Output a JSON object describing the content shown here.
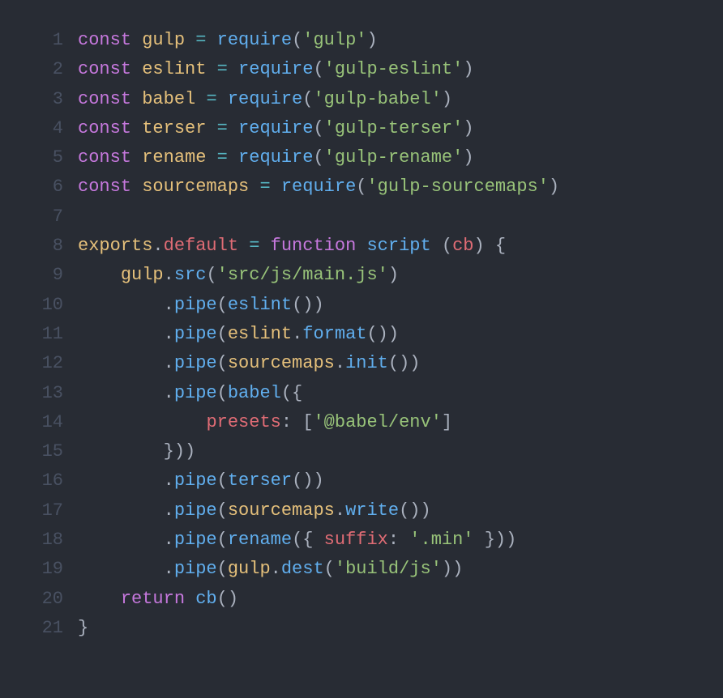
{
  "lines": [
    {
      "num": "1",
      "tokens": [
        {
          "c": "kw",
          "t": "const"
        },
        {
          "c": "pun",
          "t": " "
        },
        {
          "c": "var",
          "t": "gulp"
        },
        {
          "c": "pun",
          "t": " "
        },
        {
          "c": "op",
          "t": "="
        },
        {
          "c": "pun",
          "t": " "
        },
        {
          "c": "fn",
          "t": "require"
        },
        {
          "c": "pun",
          "t": "("
        },
        {
          "c": "str",
          "t": "'gulp'"
        },
        {
          "c": "pun",
          "t": ")"
        }
      ]
    },
    {
      "num": "2",
      "tokens": [
        {
          "c": "kw",
          "t": "const"
        },
        {
          "c": "pun",
          "t": " "
        },
        {
          "c": "var",
          "t": "eslint"
        },
        {
          "c": "pun",
          "t": " "
        },
        {
          "c": "op",
          "t": "="
        },
        {
          "c": "pun",
          "t": " "
        },
        {
          "c": "fn",
          "t": "require"
        },
        {
          "c": "pun",
          "t": "("
        },
        {
          "c": "str",
          "t": "'gulp-eslint'"
        },
        {
          "c": "pun",
          "t": ")"
        }
      ]
    },
    {
      "num": "3",
      "tokens": [
        {
          "c": "kw",
          "t": "const"
        },
        {
          "c": "pun",
          "t": " "
        },
        {
          "c": "var",
          "t": "babel"
        },
        {
          "c": "pun",
          "t": " "
        },
        {
          "c": "op",
          "t": "="
        },
        {
          "c": "pun",
          "t": " "
        },
        {
          "c": "fn",
          "t": "require"
        },
        {
          "c": "pun",
          "t": "("
        },
        {
          "c": "str",
          "t": "'gulp-babel'"
        },
        {
          "c": "pun",
          "t": ")"
        }
      ]
    },
    {
      "num": "4",
      "tokens": [
        {
          "c": "kw",
          "t": "const"
        },
        {
          "c": "pun",
          "t": " "
        },
        {
          "c": "var",
          "t": "terser"
        },
        {
          "c": "pun",
          "t": " "
        },
        {
          "c": "op",
          "t": "="
        },
        {
          "c": "pun",
          "t": " "
        },
        {
          "c": "fn",
          "t": "require"
        },
        {
          "c": "pun",
          "t": "("
        },
        {
          "c": "str",
          "t": "'gulp-terser'"
        },
        {
          "c": "pun",
          "t": ")"
        }
      ]
    },
    {
      "num": "5",
      "tokens": [
        {
          "c": "kw",
          "t": "const"
        },
        {
          "c": "pun",
          "t": " "
        },
        {
          "c": "var",
          "t": "rename"
        },
        {
          "c": "pun",
          "t": " "
        },
        {
          "c": "op",
          "t": "="
        },
        {
          "c": "pun",
          "t": " "
        },
        {
          "c": "fn",
          "t": "require"
        },
        {
          "c": "pun",
          "t": "("
        },
        {
          "c": "str",
          "t": "'gulp-rename'"
        },
        {
          "c": "pun",
          "t": ")"
        }
      ]
    },
    {
      "num": "6",
      "tokens": [
        {
          "c": "kw",
          "t": "const"
        },
        {
          "c": "pun",
          "t": " "
        },
        {
          "c": "var",
          "t": "sourcemaps"
        },
        {
          "c": "pun",
          "t": " "
        },
        {
          "c": "op",
          "t": "="
        },
        {
          "c": "pun",
          "t": " "
        },
        {
          "c": "fn",
          "t": "require"
        },
        {
          "c": "pun",
          "t": "("
        },
        {
          "c": "str",
          "t": "'gulp-sourcemaps'"
        },
        {
          "c": "pun",
          "t": ")"
        }
      ]
    },
    {
      "num": "7",
      "tokens": []
    },
    {
      "num": "8",
      "tokens": [
        {
          "c": "var",
          "t": "exports"
        },
        {
          "c": "pun",
          "t": "."
        },
        {
          "c": "prop",
          "t": "default"
        },
        {
          "c": "pun",
          "t": " "
        },
        {
          "c": "op",
          "t": "="
        },
        {
          "c": "pun",
          "t": " "
        },
        {
          "c": "kw",
          "t": "function"
        },
        {
          "c": "pun",
          "t": " "
        },
        {
          "c": "fn",
          "t": "script"
        },
        {
          "c": "pun",
          "t": " ("
        },
        {
          "c": "param",
          "t": "cb"
        },
        {
          "c": "pun",
          "t": ") {"
        }
      ]
    },
    {
      "num": "9",
      "tokens": [
        {
          "c": "pun",
          "t": "    "
        },
        {
          "c": "var",
          "t": "gulp"
        },
        {
          "c": "pun",
          "t": "."
        },
        {
          "c": "mem",
          "t": "src"
        },
        {
          "c": "pun",
          "t": "("
        },
        {
          "c": "str",
          "t": "'src/js/main.js'"
        },
        {
          "c": "pun",
          "t": ")"
        }
      ]
    },
    {
      "num": "10",
      "tokens": [
        {
          "c": "pun",
          "t": "        ."
        },
        {
          "c": "mem",
          "t": "pipe"
        },
        {
          "c": "pun",
          "t": "("
        },
        {
          "c": "fn",
          "t": "eslint"
        },
        {
          "c": "pun",
          "t": "())"
        }
      ]
    },
    {
      "num": "11",
      "tokens": [
        {
          "c": "pun",
          "t": "        ."
        },
        {
          "c": "mem",
          "t": "pipe"
        },
        {
          "c": "pun",
          "t": "("
        },
        {
          "c": "var",
          "t": "eslint"
        },
        {
          "c": "pun",
          "t": "."
        },
        {
          "c": "mem",
          "t": "format"
        },
        {
          "c": "pun",
          "t": "())"
        }
      ]
    },
    {
      "num": "12",
      "tokens": [
        {
          "c": "pun",
          "t": "        ."
        },
        {
          "c": "mem",
          "t": "pipe"
        },
        {
          "c": "pun",
          "t": "("
        },
        {
          "c": "var",
          "t": "sourcemaps"
        },
        {
          "c": "pun",
          "t": "."
        },
        {
          "c": "mem",
          "t": "init"
        },
        {
          "c": "pun",
          "t": "())"
        }
      ]
    },
    {
      "num": "13",
      "tokens": [
        {
          "c": "pun",
          "t": "        ."
        },
        {
          "c": "mem",
          "t": "pipe"
        },
        {
          "c": "pun",
          "t": "("
        },
        {
          "c": "fn",
          "t": "babel"
        },
        {
          "c": "pun",
          "t": "({"
        }
      ]
    },
    {
      "num": "14",
      "tokens": [
        {
          "c": "pun",
          "t": "            "
        },
        {
          "c": "prop",
          "t": "presets"
        },
        {
          "c": "pun",
          "t": ": ["
        },
        {
          "c": "str",
          "t": "'@babel/env'"
        },
        {
          "c": "pun",
          "t": "]"
        }
      ]
    },
    {
      "num": "15",
      "tokens": [
        {
          "c": "pun",
          "t": "        }))"
        }
      ]
    },
    {
      "num": "16",
      "tokens": [
        {
          "c": "pun",
          "t": "        ."
        },
        {
          "c": "mem",
          "t": "pipe"
        },
        {
          "c": "pun",
          "t": "("
        },
        {
          "c": "fn",
          "t": "terser"
        },
        {
          "c": "pun",
          "t": "())"
        }
      ]
    },
    {
      "num": "17",
      "tokens": [
        {
          "c": "pun",
          "t": "        ."
        },
        {
          "c": "mem",
          "t": "pipe"
        },
        {
          "c": "pun",
          "t": "("
        },
        {
          "c": "var",
          "t": "sourcemaps"
        },
        {
          "c": "pun",
          "t": "."
        },
        {
          "c": "mem",
          "t": "write"
        },
        {
          "c": "pun",
          "t": "())"
        }
      ]
    },
    {
      "num": "18",
      "tokens": [
        {
          "c": "pun",
          "t": "        ."
        },
        {
          "c": "mem",
          "t": "pipe"
        },
        {
          "c": "pun",
          "t": "("
        },
        {
          "c": "fn",
          "t": "rename"
        },
        {
          "c": "pun",
          "t": "({ "
        },
        {
          "c": "prop",
          "t": "suffix"
        },
        {
          "c": "pun",
          "t": ": "
        },
        {
          "c": "str",
          "t": "'.min'"
        },
        {
          "c": "pun",
          "t": " }))"
        }
      ]
    },
    {
      "num": "19",
      "tokens": [
        {
          "c": "pun",
          "t": "        ."
        },
        {
          "c": "mem",
          "t": "pipe"
        },
        {
          "c": "pun",
          "t": "("
        },
        {
          "c": "var",
          "t": "gulp"
        },
        {
          "c": "pun",
          "t": "."
        },
        {
          "c": "mem",
          "t": "dest"
        },
        {
          "c": "pun",
          "t": "("
        },
        {
          "c": "str",
          "t": "'build/js'"
        },
        {
          "c": "pun",
          "t": "))"
        }
      ]
    },
    {
      "num": "20",
      "tokens": [
        {
          "c": "pun",
          "t": "    "
        },
        {
          "c": "kw",
          "t": "return"
        },
        {
          "c": "pun",
          "t": " "
        },
        {
          "c": "fn",
          "t": "cb"
        },
        {
          "c": "pun",
          "t": "()"
        }
      ]
    },
    {
      "num": "21",
      "tokens": [
        {
          "c": "pun",
          "t": "}"
        }
      ]
    }
  ]
}
